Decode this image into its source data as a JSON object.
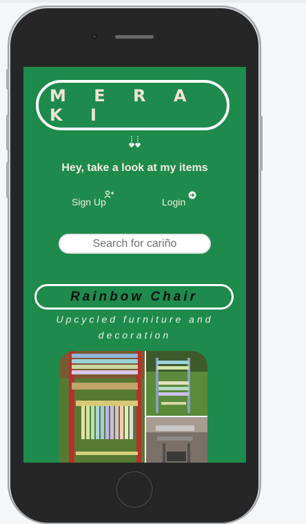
{
  "app": {
    "logo": "M E R A K I",
    "tagline": "Hey, take a look at my items"
  },
  "nav": {
    "signup_label": "Sign Up",
    "login_label": "Login"
  },
  "search": {
    "placeholder": "Search for cariño"
  },
  "product": {
    "title": "Rainbow Chair",
    "subtitle": "Upcycled furniture and decoration"
  },
  "colors": {
    "screen_bg": "#1e8a4b",
    "outline": "#ffffff",
    "logo_text": "#f0e6d0"
  }
}
